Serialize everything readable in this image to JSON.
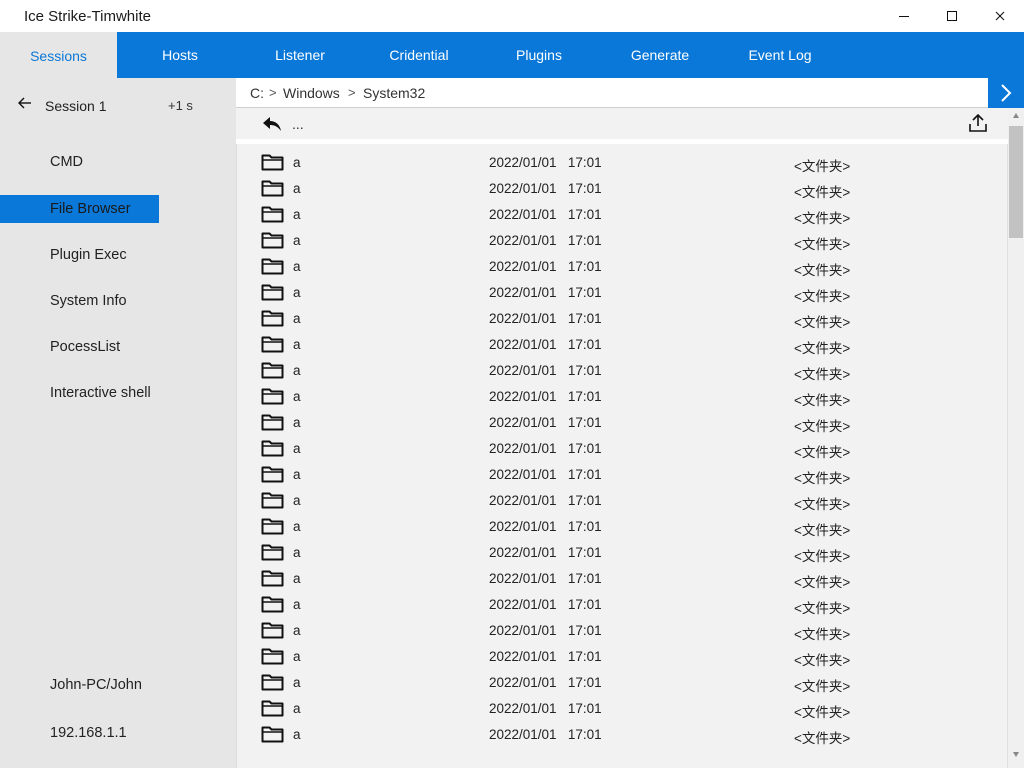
{
  "window": {
    "title": "Ice Strike-Timwhite",
    "controls": [
      "minimize-icon",
      "maximize-icon",
      "close-icon"
    ]
  },
  "nav": {
    "tabs": [
      {
        "label": "Sessions",
        "active": true
      },
      {
        "label": "Hosts",
        "active": false
      },
      {
        "label": "Listener",
        "active": false
      },
      {
        "label": "Cridential",
        "active": false
      },
      {
        "label": "Plugins",
        "active": false
      },
      {
        "label": "Generate",
        "active": false
      },
      {
        "label": "Event Log",
        "active": false
      }
    ]
  },
  "sidebar": {
    "session_title": "Session 1",
    "session_time": "+1 s",
    "items": [
      {
        "label": "CMD",
        "active": false
      },
      {
        "label": "File Browser",
        "active": true
      },
      {
        "label": "Plugin Exec",
        "active": false
      },
      {
        "label": "System Info",
        "active": false
      },
      {
        "label": "PocessList",
        "active": false
      },
      {
        "label": "Interactive shell",
        "active": false
      }
    ],
    "user": "John-PC/John",
    "ip": "192.168.1.1"
  },
  "address": {
    "crumbs": [
      "C:",
      "Windows",
      "System32"
    ],
    "separator": ">"
  },
  "toolbar": {
    "dots": "..."
  },
  "files": [
    {
      "name": "a",
      "date": "2022/01/01   17:01",
      "type": "<文件夹>"
    },
    {
      "name": "a",
      "date": "2022/01/01   17:01",
      "type": "<文件夹>"
    },
    {
      "name": "a",
      "date": "2022/01/01   17:01",
      "type": "<文件夹>"
    },
    {
      "name": "a",
      "date": "2022/01/01   17:01",
      "type": "<文件夹>"
    },
    {
      "name": "a",
      "date": "2022/01/01   17:01",
      "type": "<文件夹>"
    },
    {
      "name": "a",
      "date": "2022/01/01   17:01",
      "type": "<文件夹>"
    },
    {
      "name": "a",
      "date": "2022/01/01   17:01",
      "type": "<文件夹>"
    },
    {
      "name": "a",
      "date": "2022/01/01   17:01",
      "type": "<文件夹>"
    },
    {
      "name": "a",
      "date": "2022/01/01   17:01",
      "type": "<文件夹>"
    },
    {
      "name": "a",
      "date": "2022/01/01   17:01",
      "type": "<文件夹>"
    },
    {
      "name": "a",
      "date": "2022/01/01   17:01",
      "type": "<文件夹>"
    },
    {
      "name": "a",
      "date": "2022/01/01   17:01",
      "type": "<文件夹>"
    },
    {
      "name": "a",
      "date": "2022/01/01   17:01",
      "type": "<文件夹>"
    },
    {
      "name": "a",
      "date": "2022/01/01   17:01",
      "type": "<文件夹>"
    },
    {
      "name": "a",
      "date": "2022/01/01   17:01",
      "type": "<文件夹>"
    },
    {
      "name": "a",
      "date": "2022/01/01   17:01",
      "type": "<文件夹>"
    },
    {
      "name": "a",
      "date": "2022/01/01   17:01",
      "type": "<文件夹>"
    },
    {
      "name": "a",
      "date": "2022/01/01   17:01",
      "type": "<文件夹>"
    },
    {
      "name": "a",
      "date": "2022/01/01   17:01",
      "type": "<文件夹>"
    },
    {
      "name": "a",
      "date": "2022/01/01   17:01",
      "type": "<文件夹>"
    },
    {
      "name": "a",
      "date": "2022/01/01   17:01",
      "type": "<文件夹>"
    },
    {
      "name": "a",
      "date": "2022/01/01   17:01",
      "type": "<文件夹>"
    },
    {
      "name": "a",
      "date": "2022/01/01   17:01",
      "type": "<文件夹>"
    }
  ],
  "colors": {
    "accent": "#0a78d8",
    "sidebar_bg": "#e6e6e6",
    "content_bg": "#f2f2f2"
  },
  "icons": {
    "back": "back-arrow-icon",
    "undo": "undo-icon",
    "upload": "upload-icon",
    "go": "chevron-right-icon",
    "folder": "folder-icon"
  }
}
